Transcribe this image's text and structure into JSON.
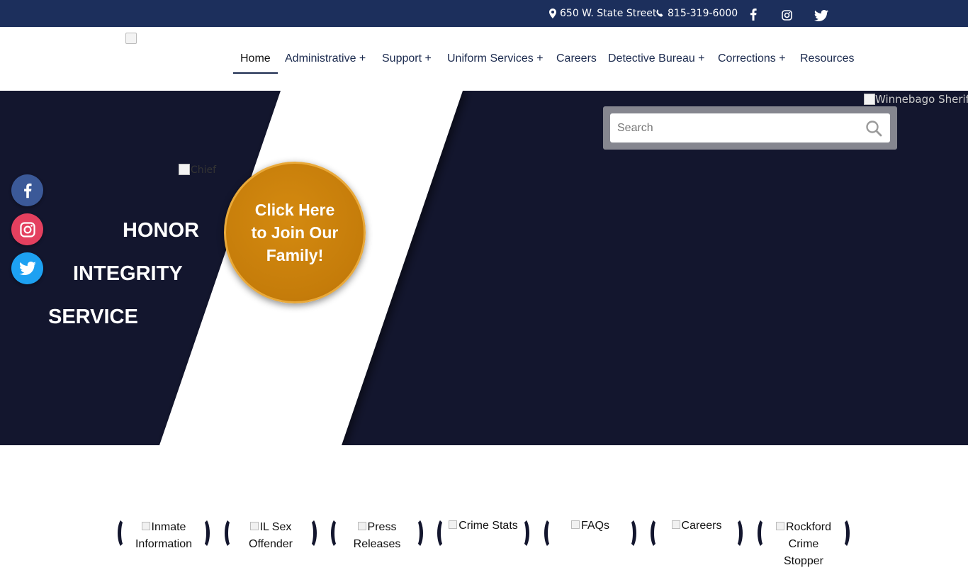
{
  "topbar": {
    "address": "650 W. State Street",
    "phone": "815-319-6000",
    "social": [
      "facebook-icon",
      "instagram-icon",
      "twitter-icon"
    ]
  },
  "nav": {
    "items": [
      {
        "label": "Home"
      },
      {
        "label": "Administrative +"
      },
      {
        "label": "Support +"
      },
      {
        "label": "Uniform Services +"
      },
      {
        "label": "Careers"
      },
      {
        "label": "Detective Bureau +"
      },
      {
        "label": "Corrections +"
      },
      {
        "label": "Resources"
      }
    ]
  },
  "hero": {
    "words": [
      "HONOR",
      "INTEGRITY",
      "SERVICE"
    ],
    "chief_alt": "Chief",
    "join_label": "Click Here to Join Our Family!",
    "sheriff_alt": "Winnebago Sheriff"
  },
  "search": {
    "placeholder": "Search"
  },
  "quick_links": [
    {
      "label": "Inmate Information"
    },
    {
      "label": "IL Sex Offender"
    },
    {
      "label": "Press Releases"
    },
    {
      "label": "Crime Stats"
    },
    {
      "label": "FAQs"
    },
    {
      "label": "Careers"
    },
    {
      "label": "Rockford Crime Stopper"
    }
  ],
  "colors": {
    "topbar": "#1c2f5c",
    "hero": "#13162e",
    "join_button": "#c57c0a",
    "facebook": "#3b5998",
    "instagram": "#e4405f",
    "twitter": "#1da1f2"
  }
}
